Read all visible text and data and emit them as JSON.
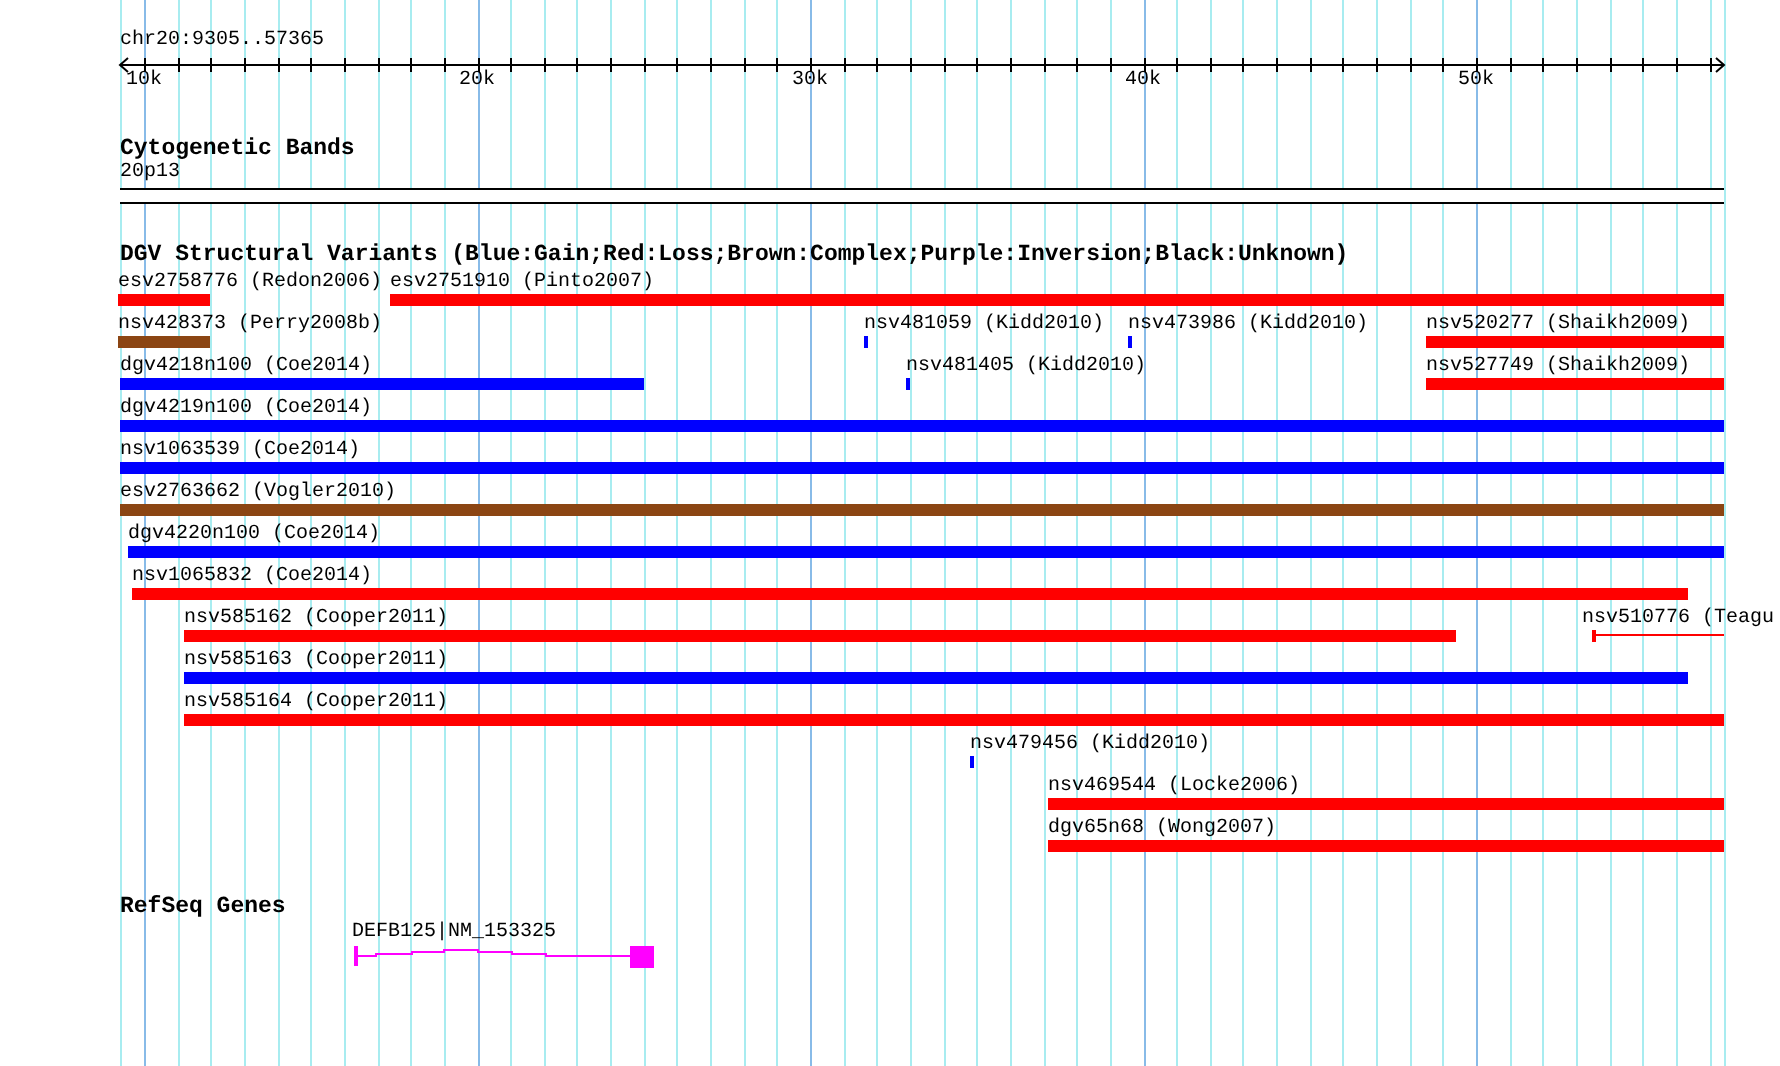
{
  "ruler": {
    "title": "chr20:9305..57365",
    "labels": [
      "10k",
      "20k",
      "30k",
      "40k",
      "50k"
    ]
  },
  "tracks": [
    {
      "kind": "bands",
      "title": "Cytogenetic Bands",
      "band": "20p13"
    },
    {
      "kind": "variants",
      "title": "DGV Structural Variants (Blue:Gain;Red:Loss;Brown:Complex;Purple:Inversion;Black:Unknown)",
      "rows": [
        {
          "features": [
            {
              "label": "esv2758776 (Redon2006)",
              "color": "#ff0000",
              "kind": "bar"
            },
            {
              "label": "esv2751910 (Pinto2007)",
              "color": "#ff0000",
              "kind": "bar"
            }
          ]
        },
        {
          "features": [
            {
              "label": "nsv428373 (Perry2008b)",
              "color": "#8b4513",
              "kind": "bar"
            },
            {
              "label": "nsv481059 (Kidd2010)",
              "color": "#0000ff",
              "kind": "bar"
            },
            {
              "label": "nsv473986 (Kidd2010)",
              "color": "#0000ff",
              "kind": "bar"
            },
            {
              "label": "nsv520277 (Shaikh2009)",
              "color": "#ff0000",
              "kind": "bar"
            }
          ]
        },
        {
          "features": [
            {
              "label": "dgv4218n100 (Coe2014)",
              "color": "#0000ff",
              "kind": "bar"
            },
            {
              "label": "nsv481405 (Kidd2010)",
              "color": "#0000ff",
              "kind": "bar"
            },
            {
              "label": "nsv527749 (Shaikh2009)",
              "color": "#ff0000",
              "kind": "bar"
            }
          ]
        },
        {
          "features": [
            {
              "label": "dgv4219n100 (Coe2014)",
              "color": "#0000ff",
              "kind": "bar"
            }
          ]
        },
        {
          "features": [
            {
              "label": "nsv1063539 (Coe2014)",
              "color": "#0000ff",
              "kind": "bar"
            }
          ]
        },
        {
          "features": [
            {
              "label": "esv2763662 (Vogler2010)",
              "color": "#8b4513",
              "kind": "bar"
            }
          ]
        },
        {
          "features": [
            {
              "label": "dgv4220n100 (Coe2014)",
              "color": "#0000ff",
              "kind": "bar"
            }
          ]
        },
        {
          "features": [
            {
              "label": "nsv1065832 (Coe2014)",
              "color": "#ff0000",
              "kind": "bar"
            }
          ]
        },
        {
          "features": [
            {
              "label": "nsv585162 (Cooper2011)",
              "color": "#ff0000",
              "kind": "bar"
            },
            {
              "label": "nsv510776 (Teagu",
              "color": "#ff0000",
              "kind": "line"
            }
          ]
        },
        {
          "features": [
            {
              "label": "nsv585163 (Cooper2011)",
              "color": "#0000ff",
              "kind": "bar"
            }
          ]
        },
        {
          "features": [
            {
              "label": "nsv585164 (Cooper2011)",
              "color": "#ff0000",
              "kind": "bar"
            }
          ]
        },
        {
          "features": [
            {
              "label": "nsv479456 (Kidd2010)",
              "color": "#0000ff",
              "kind": "bar"
            }
          ]
        },
        {
          "features": [
            {
              "label": "nsv469544 (Locke2006)",
              "color": "#ff0000",
              "kind": "bar"
            }
          ]
        },
        {
          "features": [
            {
              "label": "dgv65n68 (Wong2007)",
              "color": "#ff0000",
              "kind": "bar"
            }
          ]
        }
      ]
    },
    {
      "kind": "genes",
      "title": "RefSeq Genes",
      "genes": [
        {
          "label": "DEFB125|NM_153325",
          "color": "#ff00ff"
        }
      ]
    }
  ]
}
